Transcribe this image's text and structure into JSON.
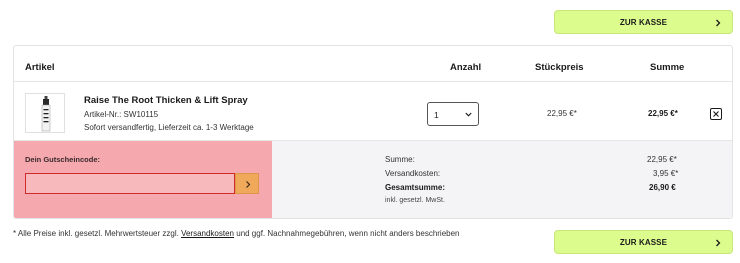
{
  "checkout_button": {
    "label": "ZUR KASSE",
    "icon": "chevron-right-icon"
  },
  "table": {
    "headers": {
      "artikel": "Artikel",
      "anzahl": "Anzahl",
      "stueckpreis": "Stückpreis",
      "summe": "Summe"
    }
  },
  "item": {
    "name": "Raise The Root Thicken & Lift Spray",
    "sku": "Artikel-Nr.: SW10115",
    "delivery": "Sofort versandfertig, Lieferzeit ca. 1-3 Werktage",
    "quantity": "1",
    "unit_price": "22,95 €*",
    "total_price": "22,95 €*",
    "remove_icon": "close-icon"
  },
  "coupon": {
    "label": "Dein Gutscheincode:",
    "value": "",
    "placeholder": "",
    "submit_icon": "chevron-right-icon"
  },
  "totals": {
    "summe_label": "Summe:",
    "summe_value": "22,95 €*",
    "versand_label": "Versandkosten:",
    "versand_value": "3,95 €*",
    "gesamt_label": "Gesamtsumme:",
    "gesamt_value": "26,90 €",
    "mwst_label": "inkl. gesetzl. MwSt."
  },
  "footnote": {
    "before": "* Alle Preise inkl. gesetzl. Mehrwertsteuer zzgl. ",
    "link": "Versandkosten",
    "after": " und ggf. Nachnahmegebühren, wenn nicht anders beschrieben"
  },
  "colors": {
    "accent": "#ddfc8e",
    "coupon_bg": "#f5a9ae",
    "coupon_button": "#f0a85b",
    "error_border": "#d02a2a"
  }
}
